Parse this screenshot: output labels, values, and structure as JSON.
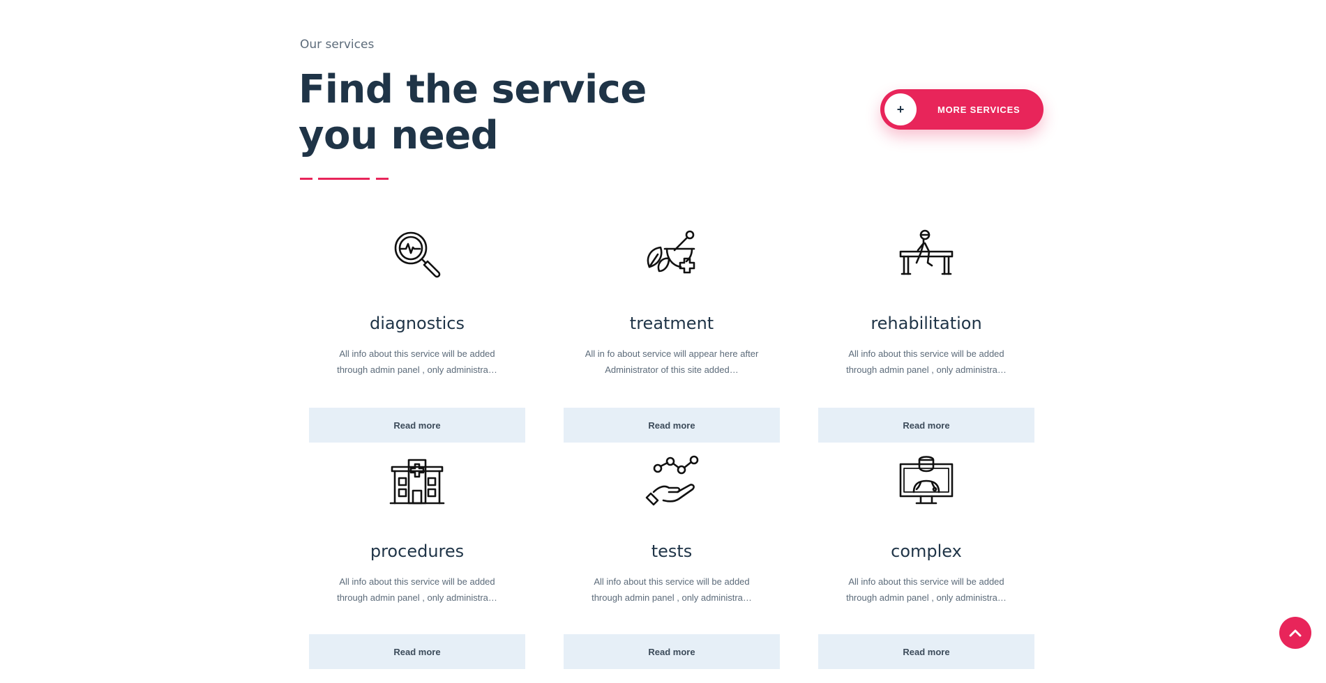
{
  "header": {
    "eyebrow": "Our services",
    "headline": "Find the service you need",
    "more_services_label": "MORE SERVICES",
    "more_services_icon": "+"
  },
  "colors": {
    "accent": "#e8255a",
    "heading": "#1f3447",
    "muted_text": "#5c6b7a",
    "button_bg": "#e6eff7"
  },
  "services": [
    {
      "title": "diagnostics",
      "icon": "magnifier-heartbeat-icon",
      "desc": "All info about this service will be added through admin panel , only administra…",
      "button": "Read more"
    },
    {
      "title": "treatment",
      "icon": "mortar-herb-cross-icon",
      "desc": "All in fo about service will appear here after Administrator of this site added…",
      "button": "Read more"
    },
    {
      "title": "rehabilitation",
      "icon": "parallel-bars-walker-icon",
      "desc": "All info about this service will be added through admin panel , only administra…",
      "button": "Read more"
    },
    {
      "title": "procedures",
      "icon": "hospital-building-icon",
      "desc": "All info about this service will be added through admin panel , only administra…",
      "button": "Read more"
    },
    {
      "title": "tests",
      "icon": "hand-chart-icon",
      "desc": "All info about this service will be added through admin panel , only administra…",
      "button": "Read more"
    },
    {
      "title": "complex",
      "icon": "doctor-monitor-icon",
      "desc": "All info about this service will be added through admin panel , only administra…",
      "button": "Read more"
    }
  ],
  "scroll_top_icon": "chevron-up-icon"
}
